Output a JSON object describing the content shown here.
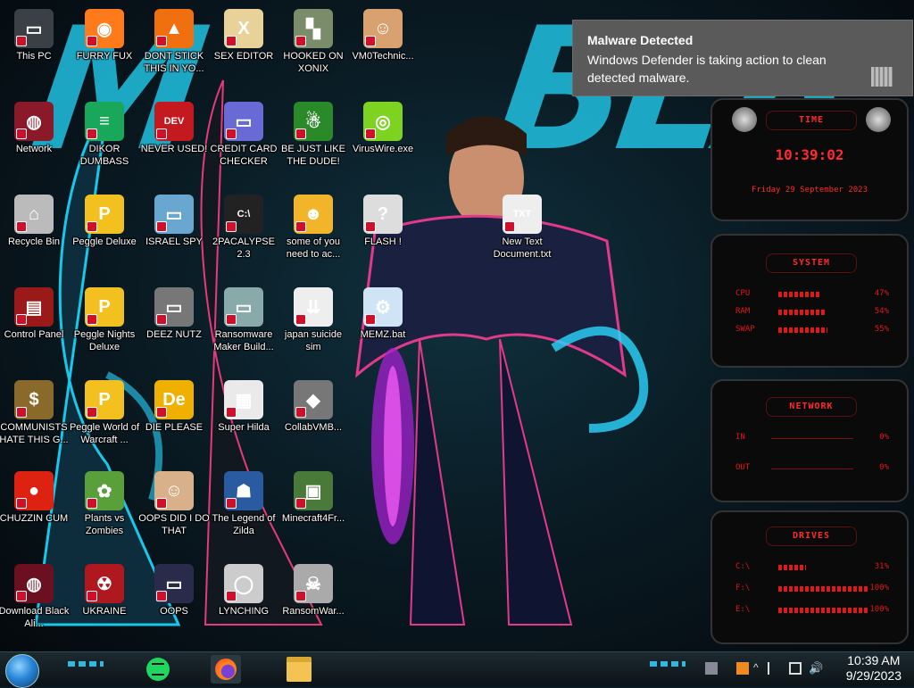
{
  "desktop": {
    "icons": [
      {
        "label": "This PC"
      },
      {
        "label": "FURRY FUX"
      },
      {
        "label": "DONT STICK THIS IN YO..."
      },
      {
        "label": "SEX EDITOR"
      },
      {
        "label": "HOOKED ON XONIX"
      },
      {
        "label": "VM0Technic..."
      },
      {
        "label": "Network"
      },
      {
        "label": "DIKOR DUMBASS"
      },
      {
        "label": "NEVER USED!"
      },
      {
        "label": "CREDIT CARD CHECKER"
      },
      {
        "label": "BE JUST LIKE THE DUDE!"
      },
      {
        "label": "VirusWire.exe"
      },
      {
        "label": "Recycle Bin"
      },
      {
        "label": "Peggle Deluxe"
      },
      {
        "label": "ISRAEL SPY"
      },
      {
        "label": "2PACALYPSE 2.3"
      },
      {
        "label": "some of you need to ac..."
      },
      {
        "label": "FLASH !"
      },
      {
        "label": "New Text Document.txt"
      },
      {
        "label": "Control Panel"
      },
      {
        "label": "Peggle Nights Deluxe"
      },
      {
        "label": "DEEZ NUTZ"
      },
      {
        "label": "Ransomware Maker Build..."
      },
      {
        "label": "japan suicide sim"
      },
      {
        "label": "MEMZ.bat"
      },
      {
        "label": "COMMUNISTS HATE THIS G..."
      },
      {
        "label": "Peggle World of Warcraft ..."
      },
      {
        "label": "DIE PLEASE"
      },
      {
        "label": "Super Hilda"
      },
      {
        "label": "CollabVMB..."
      },
      {
        "label": "CHUZZIN CUM"
      },
      {
        "label": "Plants vs Zombies"
      },
      {
        "label": "OOPS DID I DO THAT"
      },
      {
        "label": "The Legend of Zilda"
      },
      {
        "label": "Minecraft4Fr..."
      },
      {
        "label": "Download Black Ali..."
      },
      {
        "label": "UKRAINE"
      },
      {
        "label": "OOPS"
      },
      {
        "label": "LYNCHING"
      },
      {
        "label": "RansomWar..."
      }
    ]
  },
  "toast": {
    "title": "Malware Detected",
    "message": "Windows Defender is taking action to clean detected malware."
  },
  "widgets": {
    "time": {
      "title": "TIME",
      "clock": "10:39:02",
      "date": "Friday 29 September 2023"
    },
    "system": {
      "title": "SYSTEM",
      "rows": [
        {
          "name": "CPU",
          "value": "47%",
          "level": 0.47
        },
        {
          "name": "RAM",
          "value": "54%",
          "level": 0.54
        },
        {
          "name": "SWAP",
          "value": "55%",
          "level": 0.55
        }
      ]
    },
    "network": {
      "title": "NETWORK",
      "rows": [
        {
          "name": "IN",
          "value": "0%"
        },
        {
          "name": "OUT",
          "value": "0%"
        }
      ]
    },
    "drives": {
      "title": "DRIVES",
      "rows": [
        {
          "name": "C:\\",
          "value": "31%",
          "level": 0.31
        },
        {
          "name": "F:\\",
          "value": "100%",
          "level": 1.0
        },
        {
          "name": "E:\\",
          "value": "100%",
          "level": 1.0
        }
      ]
    }
  },
  "taskbar": {
    "clock_time": "10:39 AM",
    "clock_date": "9/29/2023"
  },
  "colors": {
    "accent": "#1fb7d6",
    "widget_red": "#e01818",
    "toast_bg": "#5a5a5a"
  }
}
